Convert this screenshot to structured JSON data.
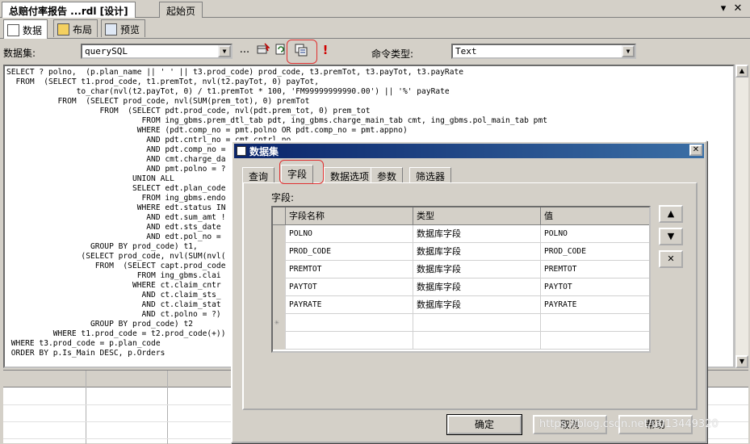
{
  "doc_tabs": [
    {
      "label": "总赔付率报告 ...rdl [设计]",
      "active": true
    },
    {
      "label": "起始页",
      "active": false
    }
  ],
  "tab_controls": {
    "dropdown": "▾",
    "close": "✕"
  },
  "view_tabs": [
    {
      "label": "数据",
      "active": true
    },
    {
      "label": "布局",
      "active": false
    },
    {
      "label": "预览",
      "active": false
    }
  ],
  "toolbar": {
    "dataset_label": "数据集:",
    "dataset_value": "querySQL",
    "ellipsis": "...",
    "command_type_label": "命令类型:",
    "command_type_value": "Text",
    "run_glyph": "!"
  },
  "sql_text": "SELECT ? polno,  (p.plan_name || ' ' || t3.prod_code) prod_code, t3.premTot, t3.payTot, t3.payRate\n  FROM  (SELECT t1.prod_code, t1.premTot, nvl(t2.payTot, 0) payTot,\n               to_char(nvl(t2.payTot, 0) / t1.premTot * 100, 'FM99999999990.00') || '%' payRate\n           FROM  (SELECT prod_code, nvl(SUM(prem_tot), 0) premTot\n                    FROM  (SELECT pdt.prod_code, nvl(pdt.prem_tot, 0) prem_tot\n                             FROM ing_gbms.prem_dtl_tab pdt, ing_gbms.charge_main_tab cmt, ing_gbms.pol_main_tab pmt\n                            WHERE (pdt.comp_no = pmt.polno OR pdt.comp_no = pmt.appno)\n                              AND pdt.cntrl_no = cmt.cntrl_no\n                              AND pdt.comp_no = \n                              AND cmt.charge_da\n                              AND pmt.polno = ?\n                           UNION ALL\n                           SELECT edt.plan_code\n                             FROM ing_gbms.endo\n                            WHERE edt.status IN\n                              AND edt.sum_amt !\n                              AND edt.sts_date\n                              AND edt.pol_no = \n                  GROUP BY prod_code) t1,\n                (SELECT prod_code, nvl(SUM(nvl(\n                   FROM  (SELECT capt.prod_code\n                            FROM ing_gbms.clai\n                           WHERE ct.claim_cntr\n                             AND ct.claim_sts_\n                             AND ct.claim_stat\n                             AND ct.polno = ?)\n                  GROUP BY prod_code) t2\n          WHERE t1.prod_code = t2.prod_code(+))\n WHERE t3.prod_code = p.plan_code\n ORDER BY p.Is_Main DESC, p.Orders",
  "dialog": {
    "title": "数据集",
    "tabs": [
      {
        "label": "查询",
        "active": false
      },
      {
        "label": "字段",
        "active": true
      },
      {
        "label": "数据选项",
        "active": false
      },
      {
        "label": "参数",
        "active": false
      },
      {
        "label": "筛选器",
        "active": false
      }
    ],
    "fields_label": "字段:",
    "columns": [
      "字段名称",
      "类型",
      "值"
    ],
    "rows": [
      {
        "name": "POLNO",
        "type": "数据库字段",
        "value": "POLNO"
      },
      {
        "name": "PROD_CODE",
        "type": "数据库字段",
        "value": "PROD_CODE"
      },
      {
        "name": "PREMTOT",
        "type": "数据库字段",
        "value": "PREMTOT"
      },
      {
        "name": "PAYTOT",
        "type": "数据库字段",
        "value": "PAYTOT"
      },
      {
        "name": "PAYRATE",
        "type": "数据库字段",
        "value": "PAYRATE"
      }
    ],
    "new_row_marker": "✳",
    "side_buttons": {
      "up": "▲",
      "down": "▼",
      "delete": "✕"
    },
    "ok_label": "确定",
    "cancel_label": "取消",
    "help_label": "帮助"
  },
  "watermark": "https://blog.csdn.net/u013449320",
  "colors": {
    "title_start": "#0a246a",
    "title_end": "#3a6ea5",
    "highlight": "#e03030"
  }
}
